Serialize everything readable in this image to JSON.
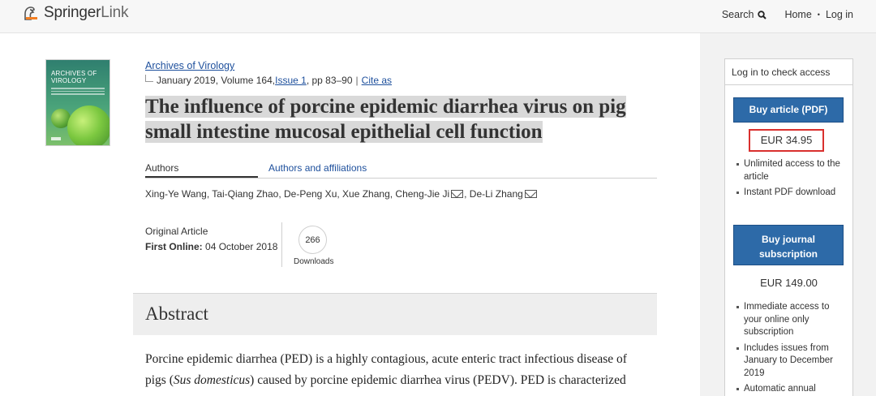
{
  "header": {
    "logo_primary": "Springer",
    "logo_secondary": "Link",
    "search_label": "Search",
    "home_label": "Home",
    "separator": "•",
    "login_label": "Log in"
  },
  "article": {
    "journal": "Archives of Virology",
    "date_volume": "January 2019, Volume 164, ",
    "issue_link": "Issue 1",
    "pages": ", pp 83–90",
    "cite_link": "Cite as",
    "title": "The influence of porcine epidemic diarrhea virus on pig small intestine mucosal epithelial cell function",
    "tabs": [
      "Authors",
      "Authors and affiliations"
    ],
    "authors": "Xing-Ye Wang, Tai-Qiang Zhao, De-Peng Xu, Xue Zhang, Cheng-Jie Ji",
    "authors_last": ", De-Li Zhang",
    "article_type": "Original Article",
    "first_online_label": "First Online:",
    "first_online_date": "04 October 2018",
    "downloads_count": "266",
    "downloads_label": "Downloads",
    "abstract_heading": "Abstract",
    "abstract_p1": "Porcine epidemic diarrhea (PED) is a highly contagious, acute enteric tract infectious disease of",
    "abstract_p2a": "pigs (",
    "abstract_p2_italic": "Sus domesticus",
    "abstract_p2b": ") caused by porcine epidemic diarrhea virus (PEDV). PED is characterized"
  },
  "cover": {
    "title_line1": "ARCHIVES OF",
    "title_line2": "VIROLOGY"
  },
  "sidebar": {
    "heading": "Log in to check access",
    "buy_article_label": "Buy article (PDF)",
    "article_price": "EUR 34.95",
    "article_benefits": [
      "Unlimited access to the article",
      "Instant PDF download"
    ],
    "buy_subscription_line1": "Buy journal",
    "buy_subscription_line2": "subscription",
    "subscription_price": "EUR 149.00",
    "subscription_benefits": [
      "Immediate access to your online only subscription",
      "Includes issues from January to December 2019",
      "Automatic annual"
    ]
  },
  "colors": {
    "link": "#1d4f9c",
    "button": "#2d6aa8",
    "highlight_box": "#d9302e",
    "logo_accent": "#f37f23"
  }
}
